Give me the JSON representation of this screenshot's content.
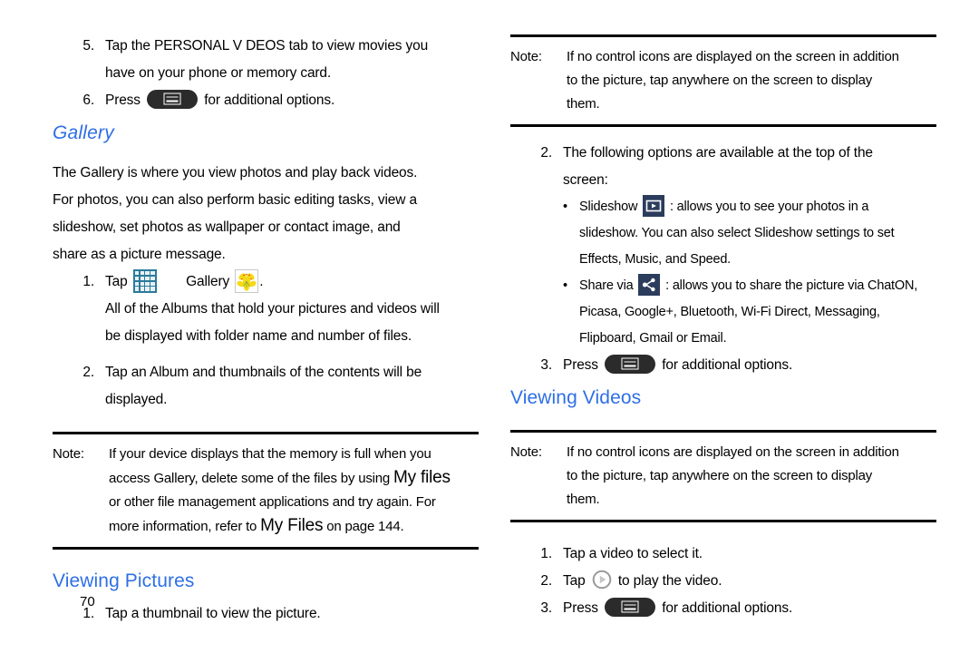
{
  "document": {
    "page_number": "70"
  },
  "colors": {
    "heading_blue": "#2f6fe4",
    "apps_icon_teal": "#2b7a9b",
    "action_icon_navy": "#2b3c5c",
    "menu_key_dark": "#2b2b2b",
    "flower_yellow": "#f5d518"
  },
  "left_column": {
    "step5": {
      "num": "5.",
      "line1_a": "Tap the ",
      "line1_b": "PERSONAL V DEOS",
      "line1_c": " tab to view movies you",
      "line2": "have on your phone or memory card."
    },
    "step6": {
      "num": "6.",
      "before_icon": "Press",
      "after_icon": "for additional options."
    },
    "gallery_heading": "Gallery",
    "gallery_intro": [
      "The Gallery is where you view photos and play back videos.",
      "For photos, you can also perform basic editing tasks, view a",
      "slideshow, set photos as wallpaper or contact image, and",
      "share as a picture message."
    ],
    "step1": {
      "num": "1.",
      "before_apps": "Tap",
      "between": "Gallery",
      "after": "."
    },
    "step1_cont": [
      "All of the Albums that hold your pictures and videos will",
      "be displayed with folder name and number of files."
    ],
    "step2": {
      "num": "2.",
      "line1": "Tap an Album and thumbnails of the contents will be",
      "line2": "displayed."
    },
    "note": {
      "label": "Note:",
      "line1": "If your device displays that the memory is full when you",
      "line2_a": "access Gallery, delete some of the files by using ",
      "line2_b": "My files",
      "line3": "or other file management applications and try again. For",
      "line4_a": "more information, refer to ",
      "line4_b": "My Files",
      "line4_c": " on page 144."
    },
    "viewing_pictures_heading": "Viewing Pictures",
    "vp_step1": {
      "num": "1.",
      "text": "Tap a thumbnail to view the picture."
    }
  },
  "right_column": {
    "note_top": {
      "label": "Note:",
      "line1": "If no control icons are displayed on the screen in addition",
      "line2": "to the picture, tap anywhere on the screen to display",
      "line3": "them."
    },
    "step2": {
      "num": "2.",
      "line1": "The following options are available at the top of the",
      "line2": "screen:"
    },
    "bullet_slideshow": {
      "dot": "•",
      "label": "Slideshow",
      "after_icon": ": allows you to see your photos in a",
      "cont1": "slideshow. You can also select Slideshow settings to set",
      "cont2": "Effects, Music, and Speed."
    },
    "bullet_share": {
      "dot": "•",
      "label": "Share via",
      "after_icon": ": allows you to share the picture via ChatON,",
      "cont1": "Picasa, Google+, Bluetooth, Wi-Fi Direct, Messaging,",
      "cont2": "Flipboard, Gmail or Email."
    },
    "step3": {
      "num": "3.",
      "before_icon": "Press",
      "after_icon": "for additional options."
    },
    "viewing_videos_heading": "Viewing Videos",
    "note_bottom": {
      "label": "Note:",
      "line1": "If no control icons are displayed on the screen in addition",
      "line2": "to the picture, tap anywhere on the screen to display",
      "line3": "them."
    },
    "vv_step1": {
      "num": "1.",
      "text": "Tap a video to select it."
    },
    "vv_step2": {
      "num": "2.",
      "before_icon": "Tap",
      "after_icon": "to play the video."
    },
    "vv_step3": {
      "num": "3.",
      "before_icon": "Press",
      "after_icon": "for additional options."
    }
  },
  "icons": {
    "menu_key": "menu-hardware-key-icon",
    "apps_grid": "apps-grid-icon",
    "gallery_flower": "gallery-flower-icon",
    "slideshow": "slideshow-icon",
    "share_via": "share-via-icon",
    "play_circle": "play-circle-icon"
  }
}
